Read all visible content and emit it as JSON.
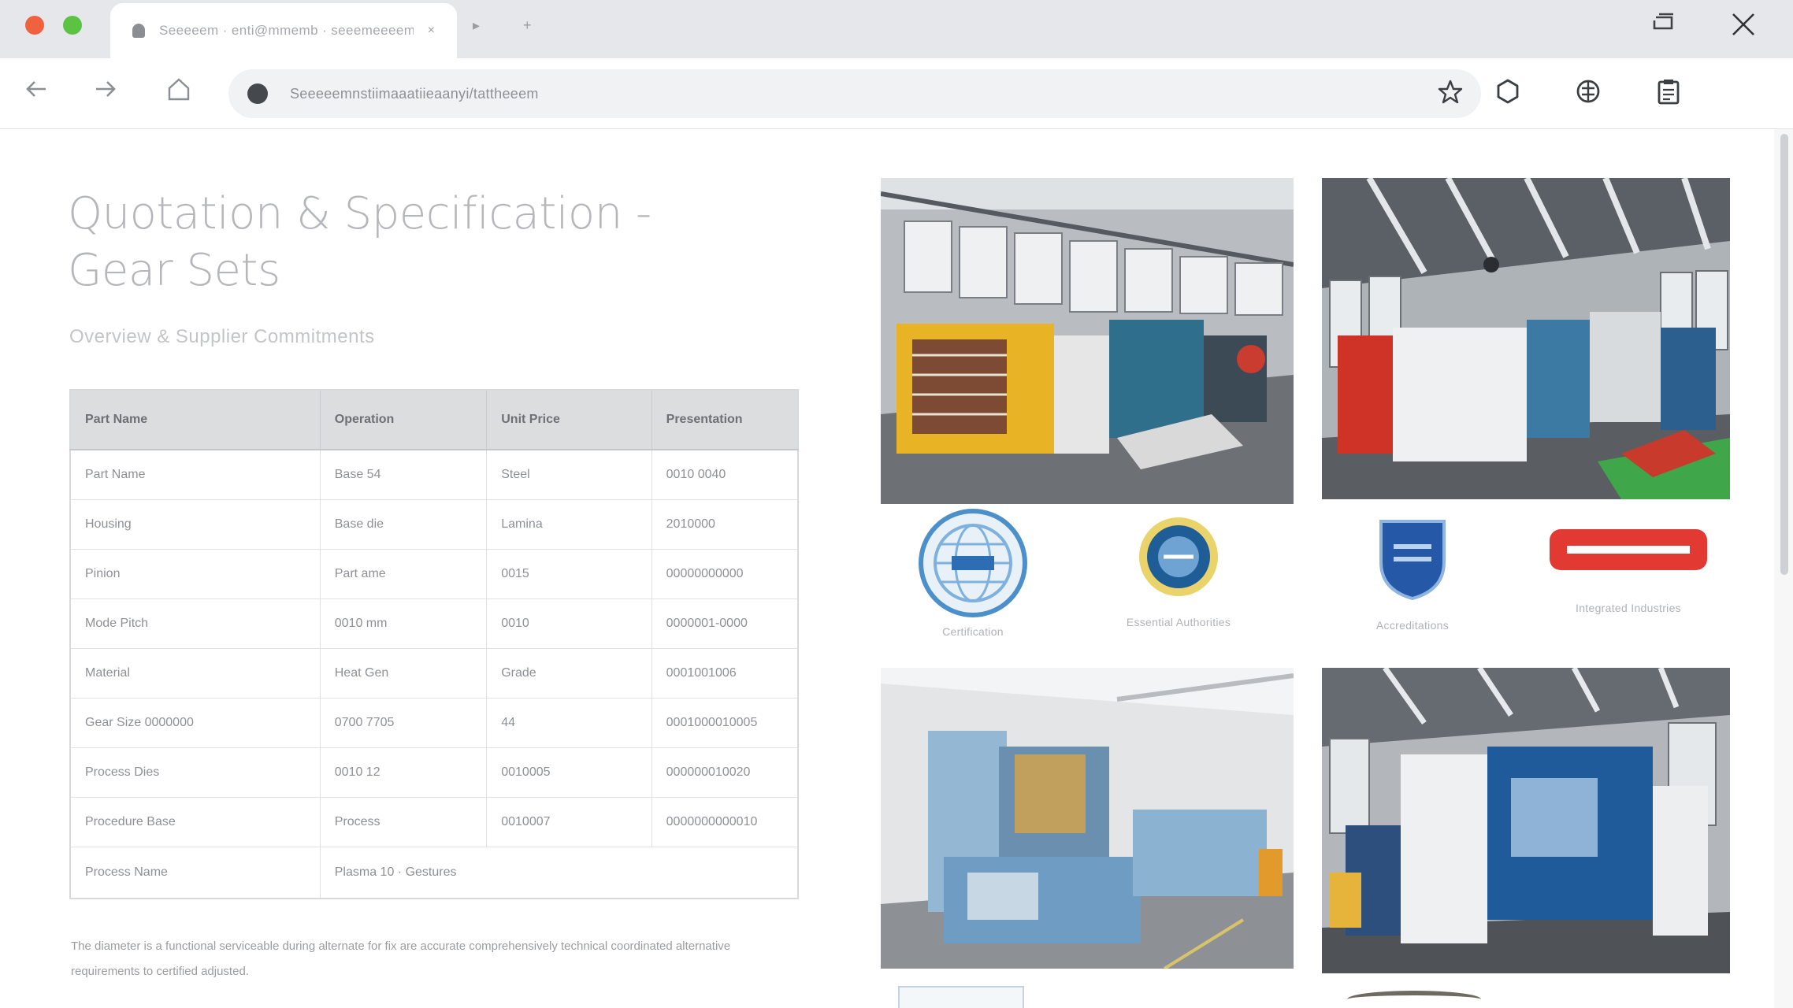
{
  "browser": {
    "tab_title": "Seeeeem · enti@mmemb · seeemeeeem",
    "tab_close": "×",
    "address_url": "Seeeeemnstiimaaatiieaanyi/tattheeem",
    "new_tab_glyph": "+",
    "tab_menu_glyph": "▸"
  },
  "page": {
    "title": "Quotation & Specification - Gear Sets",
    "subtitle": "Overview & Supplier Commitments",
    "table": {
      "headers": [
        "Part Name",
        "Operation",
        "Unit Price",
        "Presentation"
      ],
      "rows": [
        [
          "Part Name",
          "Base 54",
          "Steel",
          "0010 0040"
        ],
        [
          "Housing",
          "Base die",
          "Lamina",
          "2010000"
        ],
        [
          "Pinion",
          "Part ame",
          "0015",
          "00000000000"
        ],
        [
          "Mode Pitch",
          "0010 mm",
          "0010",
          "0000001-0000"
        ],
        [
          "Material",
          "Heat Gen",
          "Grade",
          "0001001006"
        ],
        [
          "Gear Size 0000000",
          "0700 7705",
          "44",
          "0001000010005"
        ],
        [
          "Process Dies",
          "0010 12",
          "0010005",
          "000000010020"
        ],
        [
          "Procedure Base",
          "Process",
          "0010007",
          "0000000000010"
        ],
        [
          "Process Name",
          "Plasma 10 · Gestures"
        ]
      ]
    },
    "paragraph": "The diameter is a functional serviceable during alternate for fix are accurate comprehensively technical coordinated alternative requirements to certified adjusted.",
    "logos": [
      {
        "name": "globe-seal",
        "caption": "Certification"
      },
      {
        "name": "round-emblem",
        "caption": "Essential Authorities"
      },
      {
        "name": "shield-badge",
        "caption": "Accreditations"
      },
      {
        "name": "red-banner",
        "caption": "Integrated Industries"
      }
    ]
  }
}
